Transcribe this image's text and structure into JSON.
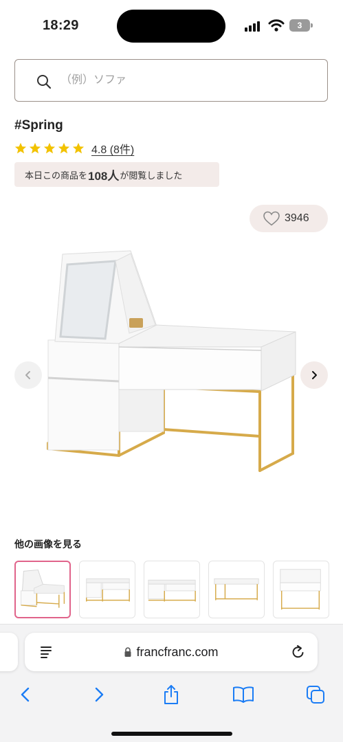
{
  "status_bar": {
    "time": "18:29",
    "battery_level": "3"
  },
  "search": {
    "placeholder": "（例）ソファ",
    "value": ""
  },
  "product": {
    "title": "#Spring",
    "star_count": 5,
    "rating_text": "4.8 (8件)",
    "views_prefix": "本日この商品を",
    "views_count": "108人",
    "views_suffix": "が閲覧しました",
    "like_count": "3946"
  },
  "gallery": {
    "heading": "他の画像を見る",
    "thumbnails": [
      {
        "view": "front-angled-open-mirror",
        "selected": true
      },
      {
        "view": "front-straight",
        "selected": false
      },
      {
        "view": "front-wide",
        "selected": false
      },
      {
        "view": "back-view",
        "selected": false
      },
      {
        "view": "side-view",
        "selected": false
      }
    ]
  },
  "browser": {
    "url": "francfranc.com"
  },
  "colors": {
    "accent_pink": "#e0638a",
    "badge_bg": "#f3ebe9",
    "star_gold": "#f2c200",
    "ios_blue": "#1a7cf5",
    "frame_gold": "#d6aa4a"
  },
  "icons": {
    "search": "search-icon",
    "heart": "heart-icon",
    "prev": "chevron-left-icon",
    "next": "chevron-right-icon",
    "reader": "reader-icon",
    "lock": "lock-icon",
    "reload": "reload-icon",
    "back": "back-icon",
    "forward": "forward-icon",
    "share": "share-icon",
    "bookmarks": "bookmarks-icon",
    "tabs": "tabs-icon"
  }
}
